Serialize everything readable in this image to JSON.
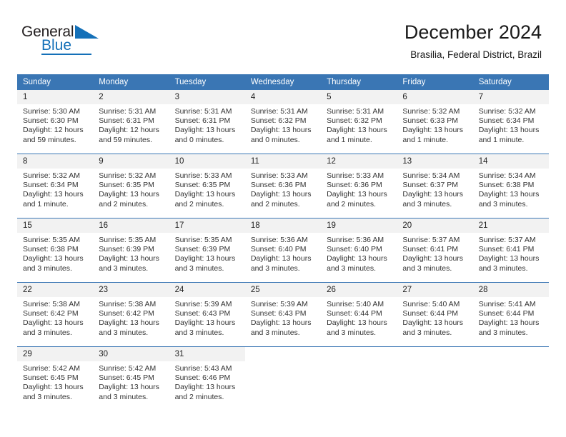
{
  "brand": {
    "name_part1": "General",
    "name_part2": "Blue",
    "triangle_color": "#1470b8"
  },
  "header": {
    "title": "December 2024",
    "subtitle": "Brasilia, Federal District, Brazil"
  },
  "colors": {
    "header_blue": "#3a76b4",
    "daynum_bg": "#f2f2f2",
    "text": "#333333"
  },
  "weekdays": [
    "Sunday",
    "Monday",
    "Tuesday",
    "Wednesday",
    "Thursday",
    "Friday",
    "Saturday"
  ],
  "labels": {
    "sunrise": "Sunrise:",
    "sunset": "Sunset:",
    "daylight": "Daylight:"
  },
  "days": [
    {
      "n": "1",
      "sunrise": "Sunrise: 5:30 AM",
      "sunset": "Sunset: 6:30 PM",
      "daylight1": "Daylight: 12 hours",
      "daylight2": "and 59 minutes."
    },
    {
      "n": "2",
      "sunrise": "Sunrise: 5:31 AM",
      "sunset": "Sunset: 6:31 PM",
      "daylight1": "Daylight: 12 hours",
      "daylight2": "and 59 minutes."
    },
    {
      "n": "3",
      "sunrise": "Sunrise: 5:31 AM",
      "sunset": "Sunset: 6:31 PM",
      "daylight1": "Daylight: 13 hours",
      "daylight2": "and 0 minutes."
    },
    {
      "n": "4",
      "sunrise": "Sunrise: 5:31 AM",
      "sunset": "Sunset: 6:32 PM",
      "daylight1": "Daylight: 13 hours",
      "daylight2": "and 0 minutes."
    },
    {
      "n": "5",
      "sunrise": "Sunrise: 5:31 AM",
      "sunset": "Sunset: 6:32 PM",
      "daylight1": "Daylight: 13 hours",
      "daylight2": "and 1 minute."
    },
    {
      "n": "6",
      "sunrise": "Sunrise: 5:32 AM",
      "sunset": "Sunset: 6:33 PM",
      "daylight1": "Daylight: 13 hours",
      "daylight2": "and 1 minute."
    },
    {
      "n": "7",
      "sunrise": "Sunrise: 5:32 AM",
      "sunset": "Sunset: 6:34 PM",
      "daylight1": "Daylight: 13 hours",
      "daylight2": "and 1 minute."
    },
    {
      "n": "8",
      "sunrise": "Sunrise: 5:32 AM",
      "sunset": "Sunset: 6:34 PM",
      "daylight1": "Daylight: 13 hours",
      "daylight2": "and 1 minute."
    },
    {
      "n": "9",
      "sunrise": "Sunrise: 5:32 AM",
      "sunset": "Sunset: 6:35 PM",
      "daylight1": "Daylight: 13 hours",
      "daylight2": "and 2 minutes."
    },
    {
      "n": "10",
      "sunrise": "Sunrise: 5:33 AM",
      "sunset": "Sunset: 6:35 PM",
      "daylight1": "Daylight: 13 hours",
      "daylight2": "and 2 minutes."
    },
    {
      "n": "11",
      "sunrise": "Sunrise: 5:33 AM",
      "sunset": "Sunset: 6:36 PM",
      "daylight1": "Daylight: 13 hours",
      "daylight2": "and 2 minutes."
    },
    {
      "n": "12",
      "sunrise": "Sunrise: 5:33 AM",
      "sunset": "Sunset: 6:36 PM",
      "daylight1": "Daylight: 13 hours",
      "daylight2": "and 2 minutes."
    },
    {
      "n": "13",
      "sunrise": "Sunrise: 5:34 AM",
      "sunset": "Sunset: 6:37 PM",
      "daylight1": "Daylight: 13 hours",
      "daylight2": "and 3 minutes."
    },
    {
      "n": "14",
      "sunrise": "Sunrise: 5:34 AM",
      "sunset": "Sunset: 6:38 PM",
      "daylight1": "Daylight: 13 hours",
      "daylight2": "and 3 minutes."
    },
    {
      "n": "15",
      "sunrise": "Sunrise: 5:35 AM",
      "sunset": "Sunset: 6:38 PM",
      "daylight1": "Daylight: 13 hours",
      "daylight2": "and 3 minutes."
    },
    {
      "n": "16",
      "sunrise": "Sunrise: 5:35 AM",
      "sunset": "Sunset: 6:39 PM",
      "daylight1": "Daylight: 13 hours",
      "daylight2": "and 3 minutes."
    },
    {
      "n": "17",
      "sunrise": "Sunrise: 5:35 AM",
      "sunset": "Sunset: 6:39 PM",
      "daylight1": "Daylight: 13 hours",
      "daylight2": "and 3 minutes."
    },
    {
      "n": "18",
      "sunrise": "Sunrise: 5:36 AM",
      "sunset": "Sunset: 6:40 PM",
      "daylight1": "Daylight: 13 hours",
      "daylight2": "and 3 minutes."
    },
    {
      "n": "19",
      "sunrise": "Sunrise: 5:36 AM",
      "sunset": "Sunset: 6:40 PM",
      "daylight1": "Daylight: 13 hours",
      "daylight2": "and 3 minutes."
    },
    {
      "n": "20",
      "sunrise": "Sunrise: 5:37 AM",
      "sunset": "Sunset: 6:41 PM",
      "daylight1": "Daylight: 13 hours",
      "daylight2": "and 3 minutes."
    },
    {
      "n": "21",
      "sunrise": "Sunrise: 5:37 AM",
      "sunset": "Sunset: 6:41 PM",
      "daylight1": "Daylight: 13 hours",
      "daylight2": "and 3 minutes."
    },
    {
      "n": "22",
      "sunrise": "Sunrise: 5:38 AM",
      "sunset": "Sunset: 6:42 PM",
      "daylight1": "Daylight: 13 hours",
      "daylight2": "and 3 minutes."
    },
    {
      "n": "23",
      "sunrise": "Sunrise: 5:38 AM",
      "sunset": "Sunset: 6:42 PM",
      "daylight1": "Daylight: 13 hours",
      "daylight2": "and 3 minutes."
    },
    {
      "n": "24",
      "sunrise": "Sunrise: 5:39 AM",
      "sunset": "Sunset: 6:43 PM",
      "daylight1": "Daylight: 13 hours",
      "daylight2": "and 3 minutes."
    },
    {
      "n": "25",
      "sunrise": "Sunrise: 5:39 AM",
      "sunset": "Sunset: 6:43 PM",
      "daylight1": "Daylight: 13 hours",
      "daylight2": "and 3 minutes."
    },
    {
      "n": "26",
      "sunrise": "Sunrise: 5:40 AM",
      "sunset": "Sunset: 6:44 PM",
      "daylight1": "Daylight: 13 hours",
      "daylight2": "and 3 minutes."
    },
    {
      "n": "27",
      "sunrise": "Sunrise: 5:40 AM",
      "sunset": "Sunset: 6:44 PM",
      "daylight1": "Daylight: 13 hours",
      "daylight2": "and 3 minutes."
    },
    {
      "n": "28",
      "sunrise": "Sunrise: 5:41 AM",
      "sunset": "Sunset: 6:44 PM",
      "daylight1": "Daylight: 13 hours",
      "daylight2": "and 3 minutes."
    },
    {
      "n": "29",
      "sunrise": "Sunrise: 5:42 AM",
      "sunset": "Sunset: 6:45 PM",
      "daylight1": "Daylight: 13 hours",
      "daylight2": "and 3 minutes."
    },
    {
      "n": "30",
      "sunrise": "Sunrise: 5:42 AM",
      "sunset": "Sunset: 6:45 PM",
      "daylight1": "Daylight: 13 hours",
      "daylight2": "and 3 minutes."
    },
    {
      "n": "31",
      "sunrise": "Sunrise: 5:43 AM",
      "sunset": "Sunset: 6:46 PM",
      "daylight1": "Daylight: 13 hours",
      "daylight2": "and 2 minutes."
    }
  ],
  "grid": {
    "leading_blanks": 0,
    "weeks": 5,
    "columns": 7
  }
}
